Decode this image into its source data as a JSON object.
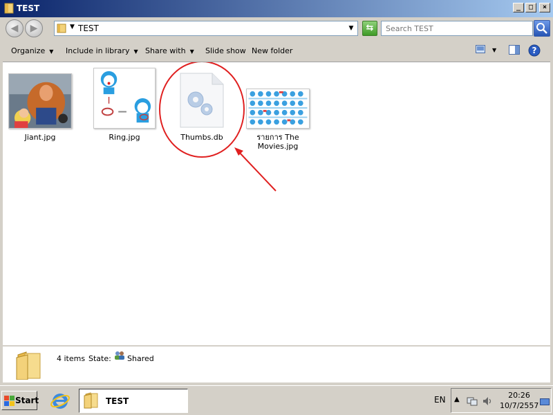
{
  "window": {
    "title": "TEST",
    "address_path": "TEST",
    "search_placeholder": "Search TEST"
  },
  "toolbar": {
    "organize": "Organize",
    "include_library": "Include in library",
    "share_with": "Share with",
    "slide_show": "Slide show",
    "new_folder": "New folder"
  },
  "files": [
    {
      "name": "Jiant.jpg"
    },
    {
      "name": "Ring.jpg"
    },
    {
      "name": "Thumbs.db"
    },
    {
      "name": "รายการ The Movies.jpg"
    }
  ],
  "details": {
    "count": "4 items",
    "state_label": "State:",
    "state_value": "Shared"
  },
  "taskbar": {
    "start": "Start",
    "task_title": "TEST",
    "lang": "EN",
    "time": "20:26",
    "date": "10/7/2557"
  },
  "colors": {
    "annotation": "#e02020",
    "titlebar_left": "#0a246a",
    "titlebar_right": "#a6caf0"
  }
}
